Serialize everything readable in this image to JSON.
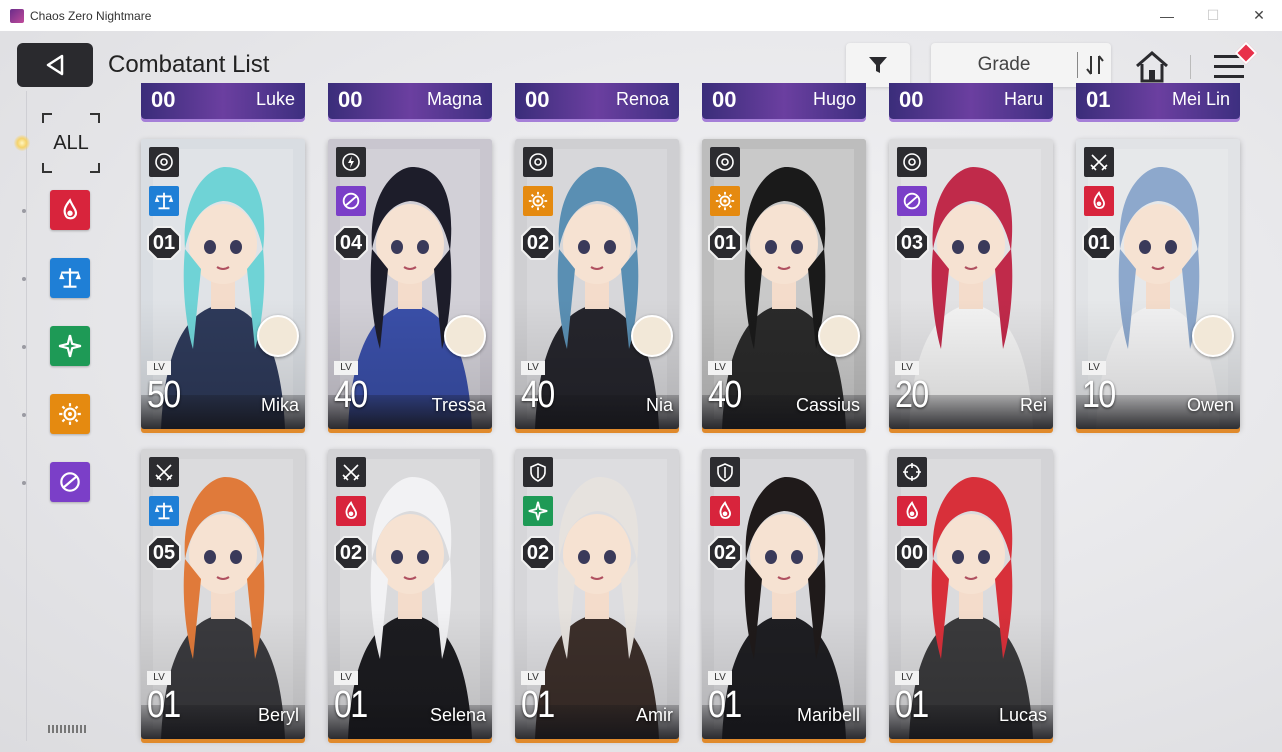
{
  "window": {
    "title": "Chaos Zero Nightmare",
    "minimize_glyph": "—",
    "maximize_glyph": "☐",
    "close_glyph": "✕"
  },
  "header": {
    "title": "Combatant List",
    "sort_label": "Grade",
    "icons": {
      "back": "back-arrow-icon",
      "filter": "filter-icon",
      "sort_order": "sort-order-icon",
      "home": "home-icon",
      "menu": "menu-icon"
    }
  },
  "sidebar": {
    "all_label": "ALL",
    "filters": [
      {
        "name": "passion",
        "color": "#d8243c"
      },
      {
        "name": "order",
        "color": "#1f7fd6"
      },
      {
        "name": "justice",
        "color": "#1e9a56"
      },
      {
        "name": "instinct",
        "color": "#e58a10"
      },
      {
        "name": "void",
        "color": "#7b3fc8"
      }
    ]
  },
  "partial_row": [
    {
      "num": "00",
      "name": "Luke"
    },
    {
      "num": "00",
      "name": "Magna"
    },
    {
      "num": "00",
      "name": "Renoa"
    },
    {
      "num": "00",
      "name": "Hugo"
    },
    {
      "num": "00",
      "name": "Haru"
    },
    {
      "num": "01",
      "name": "Mei Lin"
    }
  ],
  "lv_label": "LV",
  "cards": [
    {
      "name": "Mika",
      "level": "50",
      "grade": "01",
      "class_icon": "target-icon",
      "element": "order",
      "element_color": "#1f7fd6",
      "partner": true,
      "hair": "#6fd3d6",
      "bg": "#d9dde2",
      "outfit": "#2e3a5a"
    },
    {
      "name": "Tressa",
      "level": "40",
      "grade": "04",
      "class_icon": "lightning-icon",
      "element": "void",
      "element_color": "#7b3fc8",
      "partner": true,
      "hair": "#1d1d2a",
      "bg": "#c9c6cf",
      "outfit": "#3a4fa8"
    },
    {
      "name": "Nia",
      "level": "40",
      "grade": "02",
      "class_icon": "target-icon",
      "element": "instinct",
      "element_color": "#e58a10",
      "partner": true,
      "hair": "#5a8fb3",
      "bg": "#cfcfd2",
      "outfit": "#25252c"
    },
    {
      "name": "Cassius",
      "level": "40",
      "grade": "01",
      "class_icon": "target-icon",
      "element": "instinct",
      "element_color": "#e58a10",
      "partner": true,
      "hair": "#1a1a1a",
      "bg": "#bdbdbd",
      "outfit": "#2a2a2a"
    },
    {
      "name": "Rei",
      "level": "20",
      "grade": "03",
      "class_icon": "target-icon",
      "element": "void",
      "element_color": "#7b3fc8",
      "partner": false,
      "hair": "#c02a4a",
      "bg": "#dcdcde",
      "outfit": "#f3f3f3"
    },
    {
      "name": "Owen",
      "level": "10",
      "grade": "01",
      "class_icon": "swords-icon",
      "element": "passion",
      "element_color": "#d8243c",
      "partner": true,
      "hair": "#8da8cc",
      "bg": "#e1e3e6",
      "outfit": "#f1f1f2"
    },
    {
      "name": "Beryl",
      "level": "01",
      "grade": "05",
      "class_icon": "swords-icon",
      "element": "order",
      "element_color": "#1f7fd6",
      "partner": false,
      "hair": "#e07a3a",
      "bg": "#d4d4d6",
      "outfit": "#3a3a3e"
    },
    {
      "name": "Selena",
      "level": "01",
      "grade": "02",
      "class_icon": "swords-icon",
      "element": "passion",
      "element_color": "#d8243c",
      "partner": false,
      "hair": "#f2f2f4",
      "bg": "#d2d2d5",
      "outfit": "#1c1c20"
    },
    {
      "name": "Amir",
      "level": "01",
      "grade": "02",
      "class_icon": "shield-icon",
      "element": "justice",
      "element_color": "#1e9a56",
      "partner": false,
      "hair": "#e6e2de",
      "bg": "#d6d6d9",
      "outfit": "#3c2f2a"
    },
    {
      "name": "Maribell",
      "level": "01",
      "grade": "02",
      "class_icon": "shield-icon",
      "element": "passion",
      "element_color": "#d8243c",
      "partner": false,
      "hair": "#1f1a1a",
      "bg": "#cfcfd2",
      "outfit": "#1e1e22"
    },
    {
      "name": "Lucas",
      "level": "01",
      "grade": "00",
      "class_icon": "crosshair-icon",
      "element": "passion",
      "element_color": "#d8243c",
      "partner": false,
      "hair": "#d8303a",
      "bg": "#d3d3d6",
      "outfit": "#3a3a3c"
    }
  ]
}
